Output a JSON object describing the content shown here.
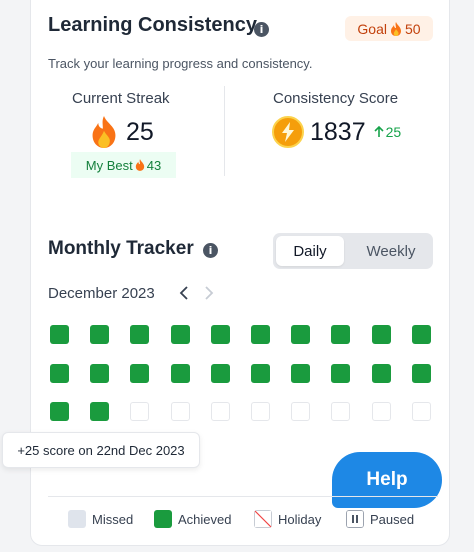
{
  "header": {
    "title": "Learning Consistency",
    "info_glyph": "i",
    "goal_label": "Goal",
    "goal_value": "50",
    "subtitle": "Track your learning progress and consistency."
  },
  "streak": {
    "label": "Current Streak",
    "value": "25",
    "best_label": "My Best",
    "best_value": "43"
  },
  "score": {
    "label": "Consistency Score",
    "value": "1837",
    "delta": "25"
  },
  "tracker": {
    "title": "Monthly Tracker",
    "tabs": [
      "Daily",
      "Weekly"
    ],
    "active_tab": "Daily",
    "month": "December 2023",
    "days": [
      "achieved",
      "achieved",
      "achieved",
      "achieved",
      "achieved",
      "achieved",
      "achieved",
      "achieved",
      "achieved",
      "achieved",
      "achieved",
      "achieved",
      "achieved",
      "achieved",
      "achieved",
      "achieved",
      "achieved",
      "achieved",
      "achieved",
      "achieved",
      "achieved",
      "achieved",
      "empty",
      "empty",
      "empty",
      "empty",
      "empty",
      "empty",
      "empty",
      "empty"
    ],
    "tooltip": "+25 score on 22nd Dec 2023"
  },
  "help_label": "Help",
  "legend": {
    "missed": "Missed",
    "achieved": "Achieved",
    "holiday": "Holiday",
    "paused": "Paused"
  },
  "colors": {
    "achieved": "#1a9b3e",
    "missed": "#dfe4ec",
    "accent_green": "#16a34a",
    "goal_orange": "#c2410c",
    "help_blue": "#1e88e5"
  },
  "icons": {
    "streak": "fire-icon",
    "score": "lightning-coin-icon",
    "delta": "arrow-up-icon",
    "prev": "chevron-left-icon",
    "next": "chevron-right-icon"
  }
}
